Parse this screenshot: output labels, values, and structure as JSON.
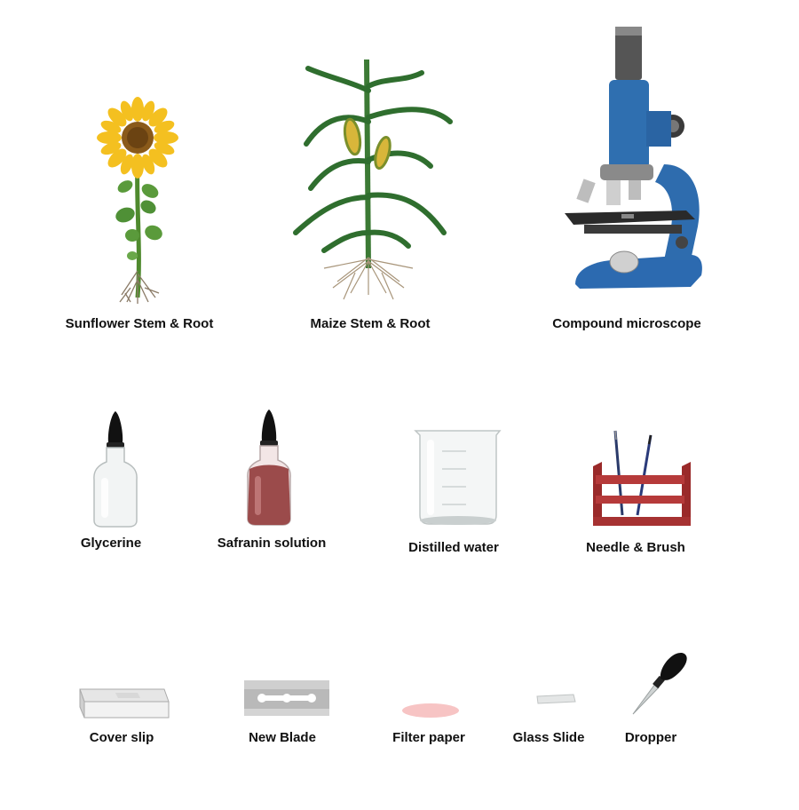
{
  "items": {
    "sunflower": {
      "label": "Sunflower Stem & Root",
      "icon": "sunflower-icon"
    },
    "maize": {
      "label": "Maize Stem & Root",
      "icon": "maize-plant-icon"
    },
    "microscope": {
      "label": "Compound microscope",
      "icon": "microscope-icon"
    },
    "glycerine": {
      "label": "Glycerine",
      "icon": "glycerine-bottle-icon"
    },
    "safranin": {
      "label": "Safranin solution",
      "icon": "safranin-bottle-icon"
    },
    "water": {
      "label": "Distilled water",
      "icon": "beaker-icon"
    },
    "needle": {
      "label": "Needle & Brush",
      "icon": "needle-brush-stand-icon"
    },
    "coverslip": {
      "label": "Cover slip",
      "icon": "cover-slip-box-icon"
    },
    "blade": {
      "label": "New Blade",
      "icon": "razor-blade-icon"
    },
    "filter": {
      "label": "Filter paper",
      "icon": "filter-paper-icon"
    },
    "slide": {
      "label": "Glass Slide",
      "icon": "glass-slide-icon"
    },
    "dropper": {
      "label": "Dropper",
      "icon": "dropper-icon"
    }
  },
  "colors": {
    "microscope_blue": "#2f6fb0",
    "safranin": "#9b4b4b",
    "rack_red": "#b63a3a",
    "leaf_green": "#3d8a3a",
    "sunflower_yellow": "#f2b51e",
    "filter_pink": "#f7c4c4"
  }
}
